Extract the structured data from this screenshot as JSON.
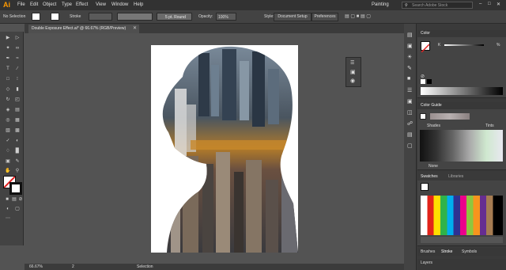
{
  "app": {
    "logo": "Ai",
    "workspace": "Painting",
    "search_placeholder": "Search Adobe Stock"
  },
  "menu": [
    "File",
    "Edit",
    "Object",
    "Type",
    "Effect",
    "View",
    "Window",
    "Help"
  ],
  "control": {
    "selection": "No Selection",
    "stroke_label": "Stroke",
    "brush_label": "5 pt. Round",
    "opacity_label": "Opacity:",
    "opacity_value": "100%",
    "style_label": "Style:",
    "doc_setup": "Document Setup",
    "preferences": "Preferences"
  },
  "document": {
    "tab_title": "Double Exposure Effect.ai* @ 66.67% (RGB/Preview)"
  },
  "status": {
    "zoom": "66.67%",
    "page": "2",
    "tool": "Selection"
  },
  "panels": {
    "color": {
      "title": "Color",
      "k_label": "K",
      "k_value": "%"
    },
    "color_guide": {
      "title": "Color Guide",
      "shades": "Shades",
      "tints": "Tints",
      "none": "None"
    },
    "swatches": {
      "tab1": "Swatches",
      "tab2": "Libraries"
    },
    "bottom_tabs": [
      "Brushes",
      "Stroke",
      "Symbols"
    ],
    "layers": {
      "title": "Layers"
    }
  }
}
